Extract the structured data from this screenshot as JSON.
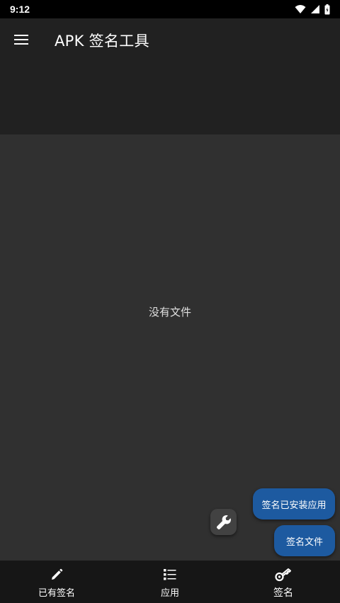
{
  "status_bar": {
    "time": "9:12"
  },
  "app_bar": {
    "title": "APK 签名工具"
  },
  "content": {
    "empty_message": "没有文件"
  },
  "actions": {
    "sign_installed_label": "签名已安装应用",
    "sign_file_label": "签名文件"
  },
  "bottom_nav": {
    "items": [
      {
        "label": "已有签名",
        "icon": "pencil-icon"
      },
      {
        "label": "应用",
        "icon": "list-icon"
      },
      {
        "label": "签名",
        "icon": "key-icon"
      }
    ]
  },
  "colors": {
    "status_bar_bg": "#000000",
    "app_bar_bg": "#212121",
    "content_bg": "#303030",
    "accent_button": "#1d5aa0",
    "bottom_nav_bg": "#161616"
  }
}
